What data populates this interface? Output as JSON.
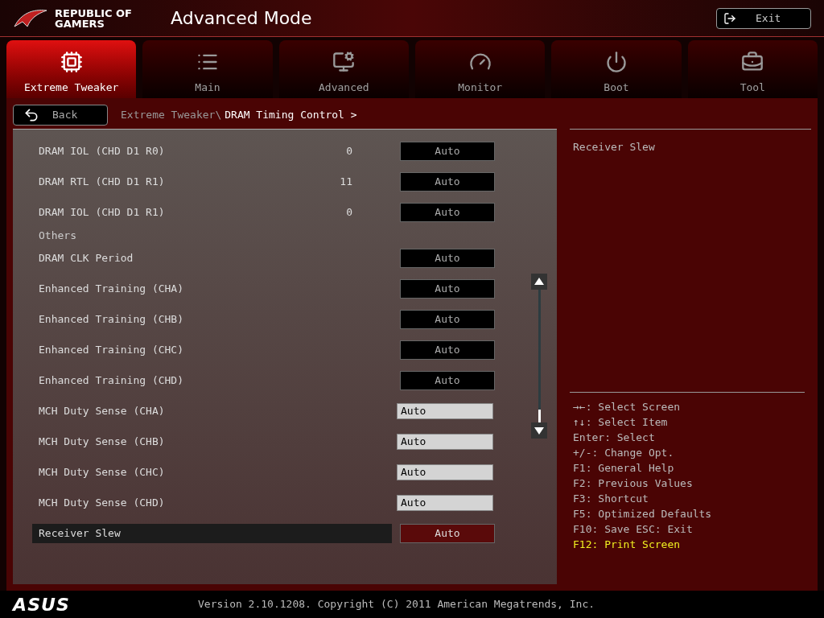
{
  "header": {
    "brand": "REPUBLIC OF GAMERS",
    "title": "Advanced Mode",
    "exit": "Exit"
  },
  "tabs": [
    {
      "label": "Extreme Tweaker",
      "selected": true
    },
    {
      "label": "Main",
      "selected": false
    },
    {
      "label": "Advanced",
      "selected": false
    },
    {
      "label": "Monitor",
      "selected": false
    },
    {
      "label": "Boot",
      "selected": false
    },
    {
      "label": "Tool",
      "selected": false
    }
  ],
  "back": "Back",
  "breadcrumb": {
    "path": "Extreme Tweaker\\",
    "current": "DRAM Timing Control >"
  },
  "settings": [
    {
      "kind": "button",
      "label": "DRAM IOL (CHD D1 R0)",
      "reading": "0",
      "value": "Auto",
      "selected": false
    },
    {
      "kind": "button",
      "label": "DRAM RTL (CHD D1 R1)",
      "reading": "11",
      "value": "Auto",
      "selected": false
    },
    {
      "kind": "button",
      "label": "DRAM IOL (CHD D1 R1)",
      "reading": "0",
      "value": "Auto",
      "selected": false
    },
    {
      "kind": "heading",
      "label": "Others"
    },
    {
      "kind": "button",
      "label": "DRAM CLK Period",
      "value": "Auto",
      "selected": false
    },
    {
      "kind": "button",
      "label": "Enhanced Training (CHA)",
      "value": "Auto",
      "selected": false
    },
    {
      "kind": "button",
      "label": "Enhanced Training (CHB)",
      "value": "Auto",
      "selected": false
    },
    {
      "kind": "button",
      "label": "Enhanced Training (CHC)",
      "value": "Auto",
      "selected": false
    },
    {
      "kind": "button",
      "label": "Enhanced Training (CHD)",
      "value": "Auto",
      "selected": false
    },
    {
      "kind": "field",
      "label": "MCH Duty Sense (CHA)",
      "value": "Auto",
      "selected": false
    },
    {
      "kind": "field",
      "label": "MCH Duty Sense (CHB)",
      "value": "Auto",
      "selected": false
    },
    {
      "kind": "field",
      "label": "MCH Duty Sense (CHC)",
      "value": "Auto",
      "selected": false
    },
    {
      "kind": "field",
      "label": "MCH Duty Sense (CHD)",
      "value": "Auto",
      "selected": false
    },
    {
      "kind": "button",
      "label": "Receiver Slew",
      "value": "Auto",
      "selected": true
    }
  ],
  "help": "Receiver Slew",
  "keys": [
    {
      "text": "→←: Select Screen",
      "highlight": false
    },
    {
      "text": "↑↓: Select Item",
      "highlight": false
    },
    {
      "text": "Enter: Select",
      "highlight": false
    },
    {
      "text": "+/-: Change Opt.",
      "highlight": false
    },
    {
      "text": "F1: General Help",
      "highlight": false
    },
    {
      "text": "F2: Previous Values",
      "highlight": false
    },
    {
      "text": "F3: Shortcut",
      "highlight": false
    },
    {
      "text": "F5: Optimized Defaults",
      "highlight": false
    },
    {
      "text": "F10: Save  ESC: Exit",
      "highlight": false
    },
    {
      "text": "F12: Print Screen",
      "highlight": true
    }
  ],
  "footer": {
    "logo": "ASUS",
    "version": "Version 2.10.1208. Copyright (C) 2011 American Megatrends, Inc."
  }
}
